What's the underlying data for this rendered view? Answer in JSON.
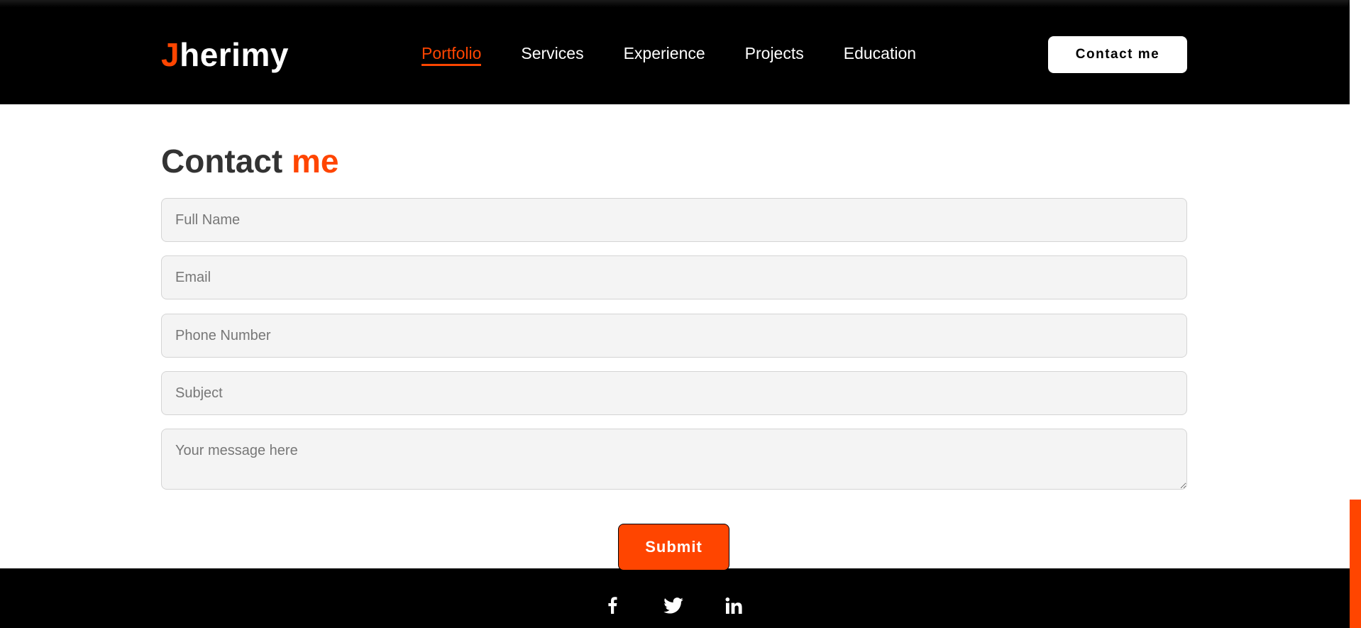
{
  "header": {
    "logo_initial": "J",
    "logo_rest": "herimy",
    "nav": [
      {
        "label": "Portfolio",
        "active": true
      },
      {
        "label": "Services"
      },
      {
        "label": "Experience"
      },
      {
        "label": "Projects"
      },
      {
        "label": "Education"
      }
    ],
    "cta_label": "Contact me"
  },
  "contact": {
    "title_main": "Contact",
    "title_accent": "me",
    "fields": {
      "full_name": {
        "placeholder": "Full Name",
        "value": ""
      },
      "email": {
        "placeholder": "Email",
        "value": ""
      },
      "phone": {
        "placeholder": "Phone Number",
        "value": ""
      },
      "subject": {
        "placeholder": "Subject",
        "value": ""
      },
      "message": {
        "placeholder": "Your message here",
        "value": ""
      }
    },
    "submit_label": "Submit"
  },
  "footer": {
    "social": [
      "facebook-icon",
      "twitter-icon",
      "linkedin-icon"
    ]
  },
  "colors": {
    "accent": "#ff4500",
    "header_bg": "#000000",
    "field_bg": "#f4f4f4"
  }
}
